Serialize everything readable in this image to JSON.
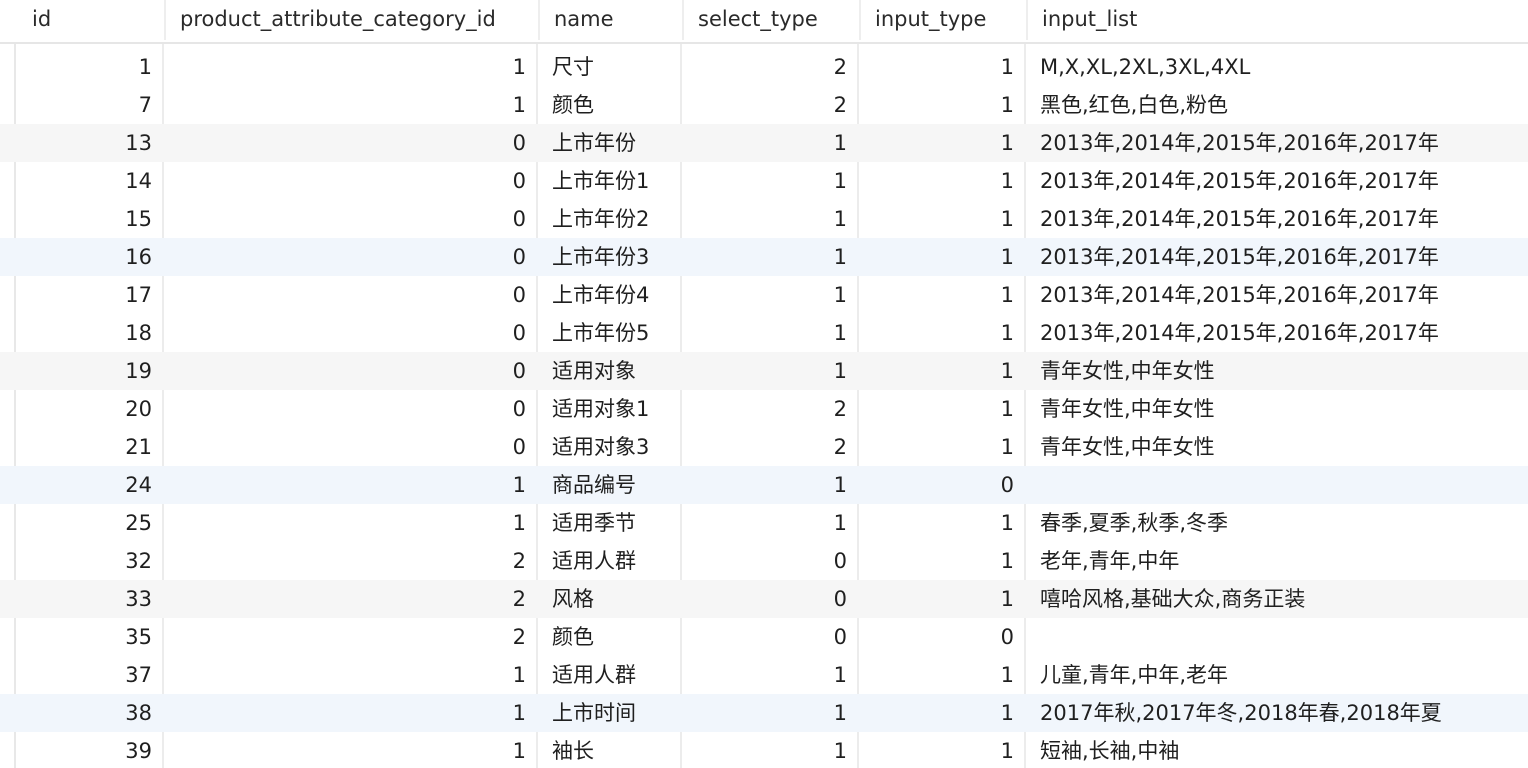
{
  "table": {
    "columns": [
      "id",
      "product_attribute_category_id",
      "name",
      "select_type",
      "input_type",
      "input_list"
    ],
    "rows": [
      {
        "id": "1",
        "pacid": "1",
        "name": "尺寸",
        "select_type": "2",
        "input_type": "1",
        "input_list": "M,X,XL,2XL,3XL,4XL"
      },
      {
        "id": "7",
        "pacid": "1",
        "name": "颜色",
        "select_type": "2",
        "input_type": "1",
        "input_list": "黑色,红色,白色,粉色"
      },
      {
        "id": "13",
        "pacid": "0",
        "name": "上市年份",
        "select_type": "1",
        "input_type": "1",
        "input_list": "2013年,2014年,2015年,2016年,2017年"
      },
      {
        "id": "14",
        "pacid": "0",
        "name": "上市年份1",
        "select_type": "1",
        "input_type": "1",
        "input_list": "2013年,2014年,2015年,2016年,2017年"
      },
      {
        "id": "15",
        "pacid": "0",
        "name": "上市年份2",
        "select_type": "1",
        "input_type": "1",
        "input_list": "2013年,2014年,2015年,2016年,2017年"
      },
      {
        "id": "16",
        "pacid": "0",
        "name": "上市年份3",
        "select_type": "1",
        "input_type": "1",
        "input_list": "2013年,2014年,2015年,2016年,2017年"
      },
      {
        "id": "17",
        "pacid": "0",
        "name": "上市年份4",
        "select_type": "1",
        "input_type": "1",
        "input_list": "2013年,2014年,2015年,2016年,2017年"
      },
      {
        "id": "18",
        "pacid": "0",
        "name": "上市年份5",
        "select_type": "1",
        "input_type": "1",
        "input_list": "2013年,2014年,2015年,2016年,2017年"
      },
      {
        "id": "19",
        "pacid": "0",
        "name": "适用对象",
        "select_type": "1",
        "input_type": "1",
        "input_list": "青年女性,中年女性"
      },
      {
        "id": "20",
        "pacid": "0",
        "name": "适用对象1",
        "select_type": "2",
        "input_type": "1",
        "input_list": "青年女性,中年女性"
      },
      {
        "id": "21",
        "pacid": "0",
        "name": "适用对象3",
        "select_type": "2",
        "input_type": "1",
        "input_list": "青年女性,中年女性"
      },
      {
        "id": "24",
        "pacid": "1",
        "name": "商品编号",
        "select_type": "1",
        "input_type": "0",
        "input_list": ""
      },
      {
        "id": "25",
        "pacid": "1",
        "name": "适用季节",
        "select_type": "1",
        "input_type": "1",
        "input_list": "春季,夏季,秋季,冬季"
      },
      {
        "id": "32",
        "pacid": "2",
        "name": "适用人群",
        "select_type": "0",
        "input_type": "1",
        "input_list": "老年,青年,中年"
      },
      {
        "id": "33",
        "pacid": "2",
        "name": "风格",
        "select_type": "0",
        "input_type": "1",
        "input_list": "嘻哈风格,基础大众,商务正装"
      },
      {
        "id": "35",
        "pacid": "2",
        "name": "颜色",
        "select_type": "0",
        "input_type": "0",
        "input_list": ""
      },
      {
        "id": "37",
        "pacid": "1",
        "name": "适用人群",
        "select_type": "1",
        "input_type": "1",
        "input_list": "儿童,青年,中年,老年"
      },
      {
        "id": "38",
        "pacid": "1",
        "name": "上市时间",
        "select_type": "1",
        "input_type": "1",
        "input_list": "2017年秋,2017年冬,2018年春,2018年夏"
      },
      {
        "id": "39",
        "pacid": "1",
        "name": "袖长",
        "select_type": "1",
        "input_type": "1",
        "input_list": "短袖,长袖,中袖"
      }
    ],
    "row_shading": [
      "none",
      "none",
      "gray",
      "none",
      "none",
      "blue",
      "none",
      "none",
      "gray",
      "none",
      "none",
      "blue",
      "none",
      "none",
      "gray",
      "none",
      "none",
      "blue",
      "none"
    ]
  }
}
